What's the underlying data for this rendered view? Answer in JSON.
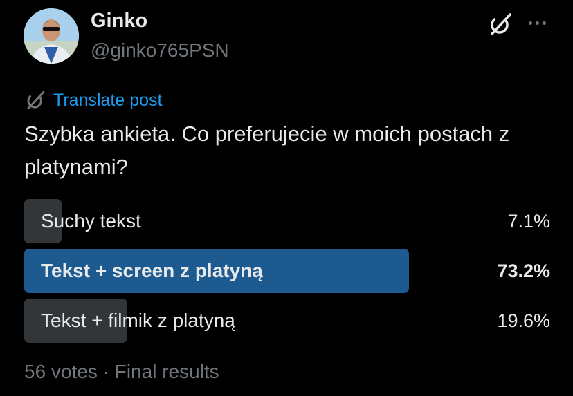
{
  "author": {
    "display_name": "Ginko",
    "handle": "@ginko765PSN",
    "avatar_icon": "profile-photo"
  },
  "header_actions": {
    "grok_icon": "grok-icon",
    "more_icon": "more-options-icon"
  },
  "translate": {
    "label": "Translate post",
    "icon": "grok-icon"
  },
  "post": {
    "text": "Szybka ankieta. Co preferujecie w moich postach z platynami?"
  },
  "poll": {
    "options": [
      {
        "label": "Suchy tekst",
        "percent_text": "7.1%",
        "percent": 7.1,
        "winner": false
      },
      {
        "label": "Tekst + screen z platyną",
        "percent_text": "73.2%",
        "percent": 73.2,
        "winner": true
      },
      {
        "label": "Tekst + filmik z platyną",
        "percent_text": "19.6%",
        "percent": 19.6,
        "winner": false
      }
    ],
    "footer": "56 votes · Final results"
  },
  "colors": {
    "background": "#000000",
    "text": "#e7e9ea",
    "secondary_text": "#71767b",
    "link": "#1d9bf0",
    "poll_bar": "#333639",
    "poll_bar_winner": "#1d5a8f"
  }
}
